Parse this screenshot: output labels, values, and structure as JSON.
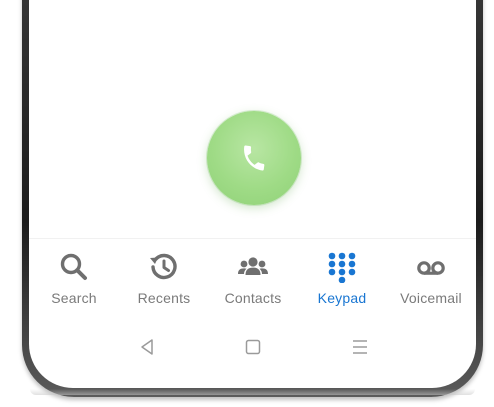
{
  "call": {
    "icon": "phone-icon",
    "color": "#9fdb86"
  },
  "tabs": [
    {
      "label": "Search",
      "icon": "search-icon",
      "active": false
    },
    {
      "label": "Recents",
      "icon": "history-icon",
      "active": false
    },
    {
      "label": "Contacts",
      "icon": "contacts-icon",
      "active": false
    },
    {
      "label": "Keypad",
      "icon": "keypad-icon",
      "active": true
    },
    {
      "label": "Voicemail",
      "icon": "voicemail-icon",
      "active": false
    }
  ],
  "colors": {
    "active": "#1976d2",
    "inactive": "#6f6f6f",
    "call_button": "#9fdb86"
  },
  "nav": {
    "back": "back-icon",
    "home": "home-icon",
    "recents": "menu-icon"
  }
}
